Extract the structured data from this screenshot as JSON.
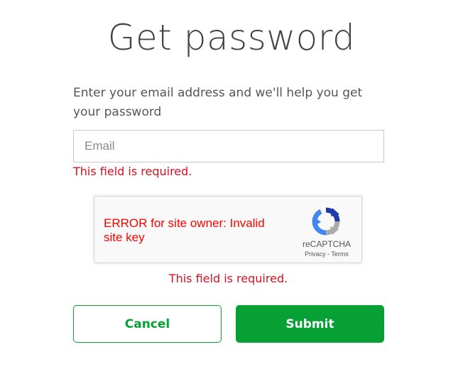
{
  "page": {
    "title": "Get password",
    "description": "Enter your email address and we'll help you get your password"
  },
  "email": {
    "placeholder": "Email",
    "value": "",
    "error": "This field is required."
  },
  "captcha": {
    "error": "ERROR for site owner: Invalid site key",
    "brand": "reCAPTCHA",
    "privacy_label": "Privacy",
    "separator": " - ",
    "terms_label": "Terms",
    "field_error": "This field is required.",
    "logo_icon": "recaptcha-logo-icon"
  },
  "buttons": {
    "cancel_label": "Cancel",
    "submit_label": "Submit"
  },
  "colors": {
    "accent": "#07a035",
    "error": "#d4101f",
    "captcha_error": "#ff0000"
  }
}
